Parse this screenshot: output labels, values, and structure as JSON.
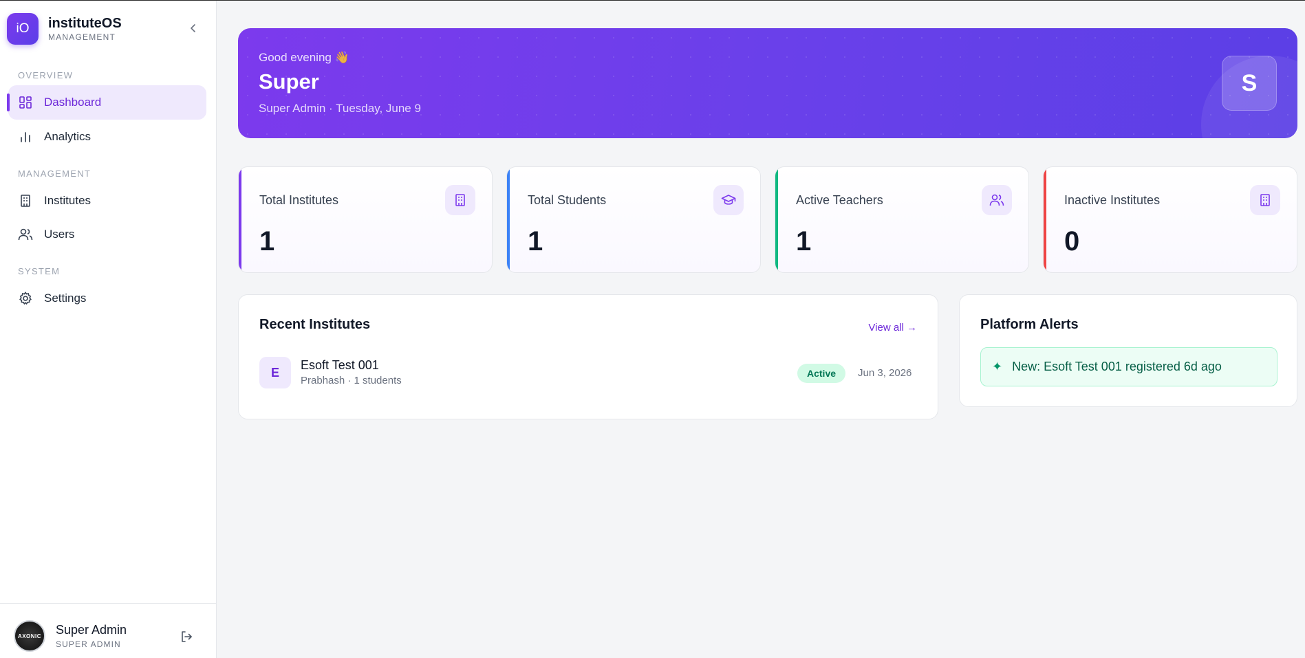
{
  "app": {
    "name": "instituteOS",
    "subtitle": "MANAGEMENT",
    "logo_text": "iO",
    "accent": "#7c3aed"
  },
  "sidebar": {
    "sections": [
      {
        "title": "OVERVIEW"
      },
      {
        "title": "MANAGEMENT"
      },
      {
        "title": "SYSTEM"
      }
    ],
    "items": [
      {
        "label": "Dashboard",
        "icon": "dashboard-icon",
        "active": true
      },
      {
        "label": "Analytics",
        "icon": "bar-chart-icon"
      },
      {
        "label": "Institutes",
        "icon": "building-icon"
      },
      {
        "label": "Users",
        "icon": "users-icon"
      },
      {
        "label": "Settings",
        "icon": "gear-icon"
      }
    ],
    "user": {
      "name": "Super Admin",
      "role": "SUPER ADMIN",
      "avatar_text": "AXONIC"
    }
  },
  "hero": {
    "greeting": "Good evening 👋",
    "name": "Super",
    "subtitle": "Super Admin · Tuesday, June 9",
    "avatar_letter": "S"
  },
  "stats": [
    {
      "label": "Total Institutes",
      "value": "1",
      "accent": "#7c3aed",
      "icon": "building-icon"
    },
    {
      "label": "Total Students",
      "value": "1",
      "accent": "#3b82f6",
      "icon": "graduation-cap-icon"
    },
    {
      "label": "Active Teachers",
      "value": "1",
      "accent": "#10b981",
      "icon": "users-icon"
    },
    {
      "label": "Inactive Institutes",
      "value": "0",
      "accent": "#ef4444",
      "icon": "building-icon"
    }
  ],
  "recent": {
    "title": "Recent Institutes",
    "view_all": "View all →",
    "items": [
      {
        "initial": "E",
        "name": "Esoft Test 001",
        "meta": "Prabhash · 1 students",
        "status": "Active",
        "date": "Jun 3, 2026"
      }
    ]
  },
  "alerts": {
    "title": "Platform Alerts",
    "items": [
      {
        "icon": "sparkle-icon",
        "glyph": "✦",
        "text": "New: Esoft Test 001 registered 6d ago"
      }
    ]
  }
}
